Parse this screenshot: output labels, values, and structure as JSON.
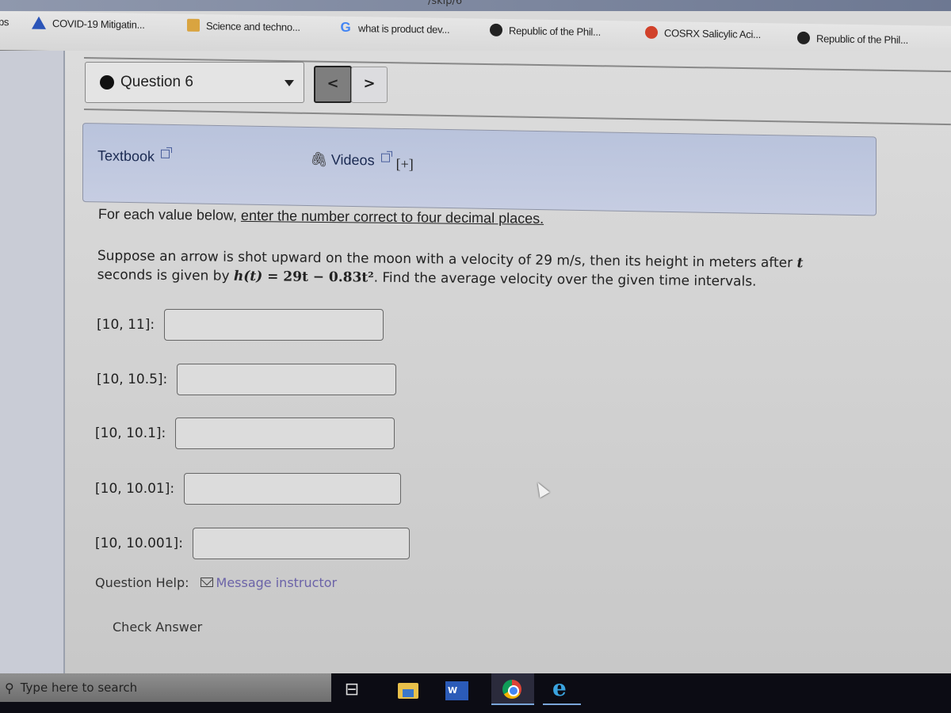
{
  "browser": {
    "url_fragment": "/skip/6",
    "bookmarks": [
      {
        "label": "ps",
        "icon": "apps-icon"
      },
      {
        "label": "COVID-19 Mitigatin...",
        "icon": "triangle-logo-icon"
      },
      {
        "label": "Science and techno...",
        "icon": "science-logo-icon"
      },
      {
        "label": "what is product dev...",
        "icon": "google-icon"
      },
      {
        "label": "Republic of the Phil...",
        "icon": "globe-icon"
      },
      {
        "label": "COSRX Salicylic Aci...",
        "icon": "cosrx-icon"
      },
      {
        "label": "Republic of the Phil...",
        "icon": "globe-icon"
      }
    ]
  },
  "question_nav": {
    "selected_question": "Question 6",
    "prev_label": "<",
    "next_label": ">"
  },
  "resources": {
    "textbook_label": "Textbook",
    "videos_label": "Videos",
    "expand_label": "[+]"
  },
  "problem": {
    "instruction_prefix": "For each value below, ",
    "instruction_link": "enter the number correct to four decimal places.",
    "text_line1": "Suppose an arrow is shot upward on the moon with a velocity of 29 m/s, then its height in meters after ",
    "text_var_t": "t",
    "text_line2": " seconds is given by ",
    "formula_lhs": "h(t)",
    "formula_rhs": " = 29t − 0.83t²",
    "text_line3": ". Find the average velocity over the given time intervals."
  },
  "answers": [
    {
      "label": "[10, 11]:",
      "value": ""
    },
    {
      "label": "[10, 10.5]:",
      "value": ""
    },
    {
      "label": "[10, 10.1]:",
      "value": ""
    },
    {
      "label": "[10, 10.01]:",
      "value": ""
    },
    {
      "label": "[10, 10.001]:",
      "value": ""
    }
  ],
  "help": {
    "label": "Question Help:",
    "message_link": "Message instructor"
  },
  "check_answer_label": "Check Answer",
  "taskbar": {
    "search_placeholder": "Type here to search",
    "apps": [
      "task-view",
      "file-explorer",
      "word",
      "chrome",
      "internet-explorer"
    ]
  }
}
